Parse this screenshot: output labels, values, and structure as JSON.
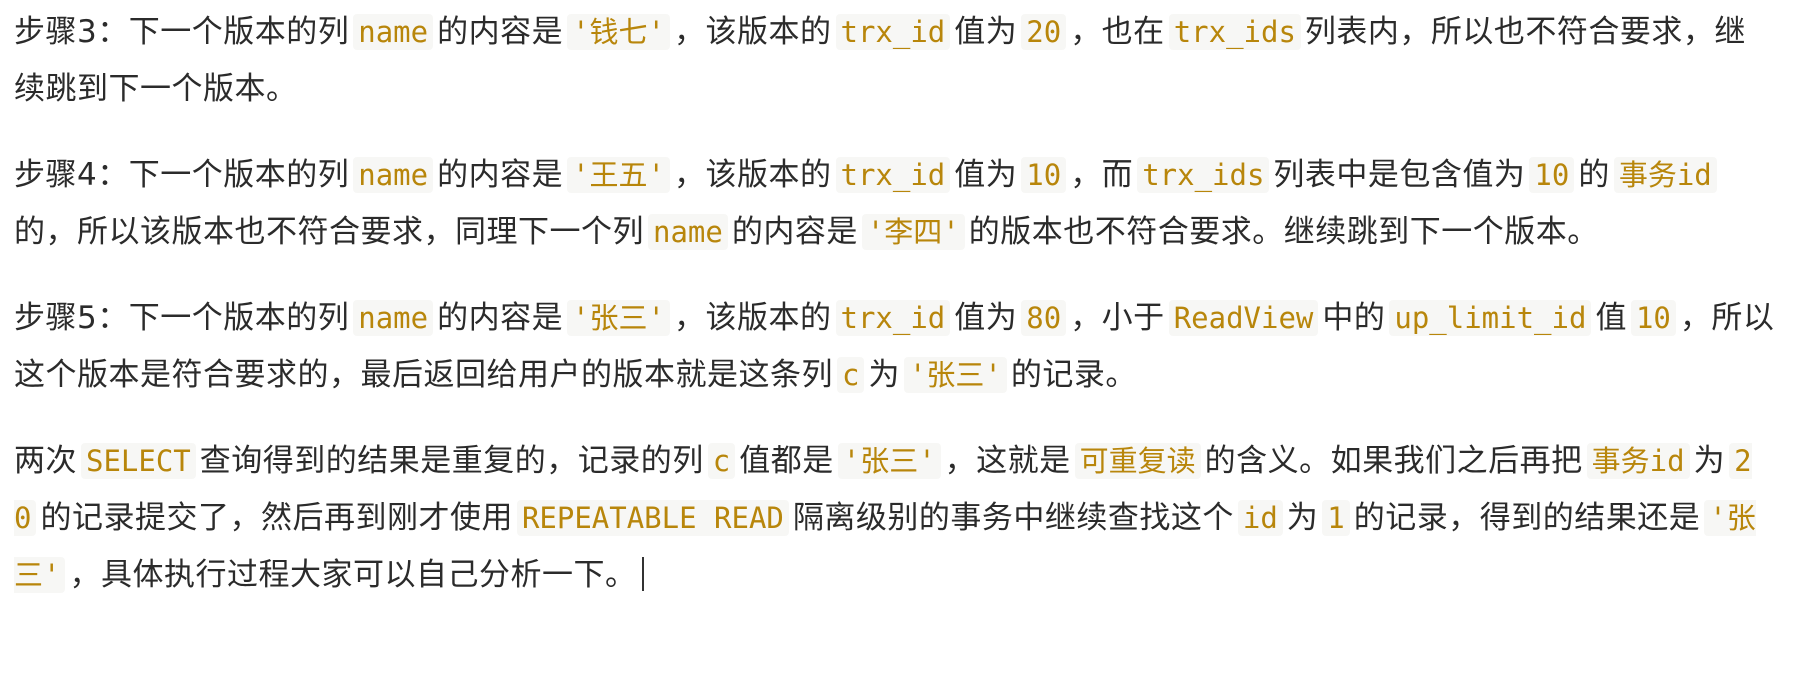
{
  "paragraphs": [
    {
      "segments": [
        {
          "t": "步骤3：下一个版本的列"
        },
        {
          "t": "name",
          "code": true
        },
        {
          "t": "的内容是"
        },
        {
          "t": "'钱七'",
          "code": true
        },
        {
          "t": "，该版本的"
        },
        {
          "t": "trx_id",
          "code": true
        },
        {
          "t": "值为"
        },
        {
          "t": "20",
          "code": true
        },
        {
          "t": "，也在"
        },
        {
          "t": "trx_ids",
          "code": true
        },
        {
          "t": "列表内，所以也不符合要求，继续跳到下一个版本。"
        }
      ]
    },
    {
      "segments": [
        {
          "t": "步骤4：下一个版本的列"
        },
        {
          "t": "name",
          "code": true
        },
        {
          "t": "的内容是"
        },
        {
          "t": "'王五'",
          "code": true
        },
        {
          "t": "，该版本的"
        },
        {
          "t": "trx_id",
          "code": true
        },
        {
          "t": "值为"
        },
        {
          "t": "10",
          "code": true
        },
        {
          "t": "，而"
        },
        {
          "t": "trx_ids",
          "code": true
        },
        {
          "t": "列表中是包含值为"
        },
        {
          "t": "10",
          "code": true
        },
        {
          "t": "的"
        },
        {
          "t": "事务id",
          "code": true
        },
        {
          "t": "的，所以该版本也不符合要求，同理下一个列"
        },
        {
          "t": "name",
          "code": true
        },
        {
          "t": "的内容是"
        },
        {
          "t": "'李四'",
          "code": true
        },
        {
          "t": "的版本也不符合要求。继续跳到下一个版本。"
        }
      ]
    },
    {
      "segments": [
        {
          "t": "步骤5：下一个版本的列"
        },
        {
          "t": "name",
          "code": true
        },
        {
          "t": "的内容是"
        },
        {
          "t": "'张三'",
          "code": true
        },
        {
          "t": "，该版本的"
        },
        {
          "t": "trx_id",
          "code": true
        },
        {
          "t": "值为"
        },
        {
          "t": "80",
          "code": true
        },
        {
          "t": "，小于"
        },
        {
          "t": "ReadView",
          "code": true
        },
        {
          "t": "中的"
        },
        {
          "t": "up_limit_id",
          "code": true
        },
        {
          "t": "值"
        },
        {
          "t": "10",
          "code": true
        },
        {
          "t": "，所以这个版本是符合要求的，最后返回给用户的版本就是这条列"
        },
        {
          "t": "c",
          "code": true
        },
        {
          "t": "为"
        },
        {
          "t": "'张三'",
          "code": true
        },
        {
          "t": "的记录。"
        }
      ]
    },
    {
      "segments": [
        {
          "t": "两次"
        },
        {
          "t": "SELECT",
          "code": true
        },
        {
          "t": "查询得到的结果是重复的，记录的列"
        },
        {
          "t": "c",
          "code": true
        },
        {
          "t": "值都是"
        },
        {
          "t": "'张三'",
          "code": true
        },
        {
          "t": "，这就是"
        },
        {
          "t": "可重复读",
          "code": true
        },
        {
          "t": "的含义。如果我们之后再把"
        },
        {
          "t": "事务id",
          "code": true
        },
        {
          "t": "为"
        },
        {
          "t": "20",
          "code": true
        },
        {
          "t": "的记录提交了，然后再到刚才使用"
        },
        {
          "t": "REPEATABLE READ",
          "code": true
        },
        {
          "t": "隔离级别的事务中继续查找这个"
        },
        {
          "t": "id",
          "code": true
        },
        {
          "t": "为"
        },
        {
          "t": "1",
          "code": true
        },
        {
          "t": "的记录，得到的结果还是"
        },
        {
          "t": "'张三'",
          "code": true
        },
        {
          "t": "，具体执行过程大家可以自己分析一下。"
        }
      ]
    }
  ]
}
